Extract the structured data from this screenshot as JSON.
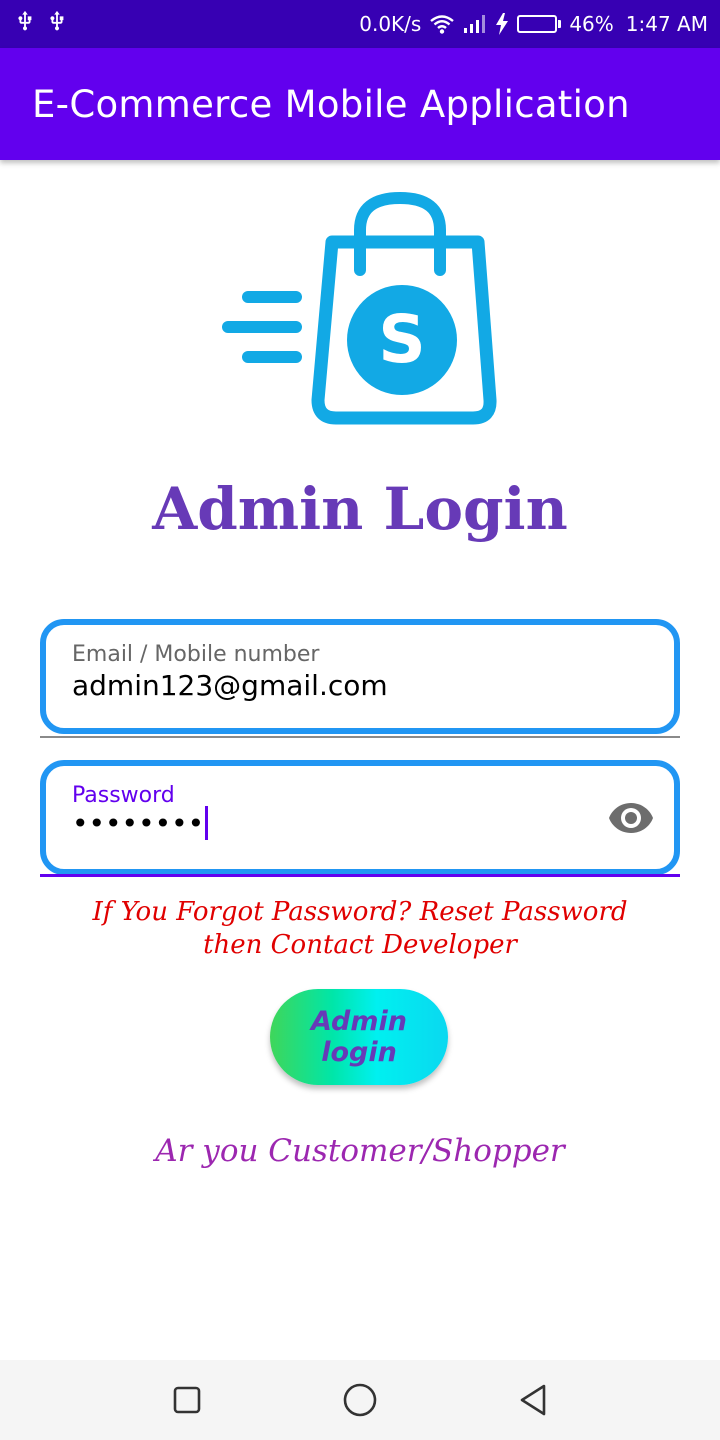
{
  "status_bar": {
    "left_icons": [
      "usb-icon",
      "usb-icon"
    ],
    "net_speed": "0.0K/s",
    "battery_percent": "46%",
    "battery_level": 0.46,
    "time": "1:47 AM"
  },
  "app_bar": {
    "title": "E-Commerce Mobile Application"
  },
  "logo": {
    "icon": "shopping-bag-logo",
    "letter": "S",
    "color": "#12a9e5"
  },
  "login": {
    "heading": "Admin Login",
    "email_label": "Email / Mobile number",
    "email_value": "admin123@gmail.com",
    "password_label": "Password",
    "password_value": "••••••••",
    "forgot_line1": "If You Forgot Password? Reset Password",
    "forgot_line2": "then Contact Developer",
    "button_label": "Admin login",
    "customer_link": "Ar you Customer/Shopper"
  },
  "colors": {
    "status_bar": "#3700b3",
    "app_bar": "#6200ee",
    "field_border": "#2196f3",
    "heading": "#673ab7",
    "forgot_text": "#e00000",
    "customer_link": "#9c27b0"
  },
  "nav_bar": {
    "buttons": [
      "recent-apps-icon",
      "home-icon",
      "back-icon"
    ]
  }
}
